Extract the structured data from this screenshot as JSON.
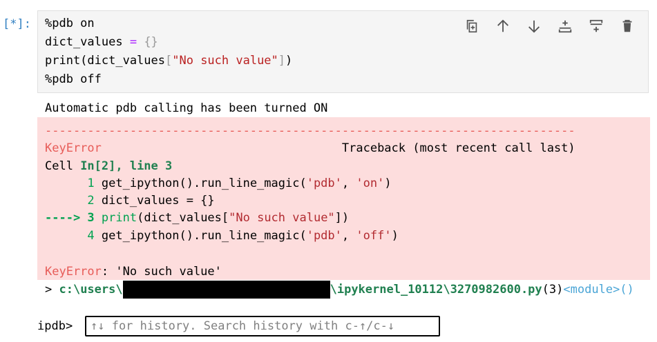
{
  "cell": {
    "prompt": "[*]:",
    "code": {
      "line1": "%pdb on",
      "line2_var": "dict_values ",
      "line2_op": "=",
      "line2_brace": " {}",
      "line3_pre": "print(dict_values",
      "line3_open": "[",
      "line3_str": "\"No such value\"",
      "line3_close": "]",
      "line3_end": ")",
      "line4": "%pdb off"
    },
    "toolbar": {
      "icons": [
        "duplicate-icon",
        "move-up-icon",
        "move-down-icon",
        "insert-above-icon",
        "insert-below-icon",
        "delete-icon"
      ]
    }
  },
  "output": {
    "info": "Automatic pdb calling has been turned ON",
    "traceback": {
      "dashes": "---------------------------------------------------------------------------",
      "error_name": "KeyError",
      "spacer": "                                  ",
      "traceback_label": "Traceback (most recent call last)",
      "cell_prefix": "Cell ",
      "cell_ref": "In[2], line 3",
      "lines": [
        {
          "marker": "      1 ",
          "code_a": "get_ipython().run_line_magic(",
          "arg1": "'pdb'",
          "sep": ", ",
          "arg2": "'on'",
          "end": ")"
        },
        {
          "marker": "      2 ",
          "code": "dict_values = {}"
        },
        {
          "marker": "----> 3 ",
          "fn": "print",
          "code_a": "(dict_values[",
          "str": "\"No such value\"",
          "end": "])"
        },
        {
          "marker": "      4 ",
          "code_a": "get_ipython().run_line_magic(",
          "arg1": "'pdb'",
          "sep": ", ",
          "arg2": "'off'",
          "end": ")"
        }
      ],
      "final_name": "KeyError",
      "final_msg": ": 'No such value'"
    }
  },
  "pdb": {
    "loc_prefix": "> ",
    "loc_path1": "c:\\users\\",
    "loc_path2": "\\ipykernel_10112\\3270982600.py",
    "loc_line": "(3)",
    "loc_module": "<module>",
    "loc_parens": "()",
    "prompt": "ipdb>",
    "input_placeholder": "↑↓ for history. Search history with c-↑/c-↓"
  },
  "colors": {
    "prompt": "#307fc1",
    "error_bg": "#fddddd",
    "green": "#00a250",
    "red": "#e75c58"
  }
}
